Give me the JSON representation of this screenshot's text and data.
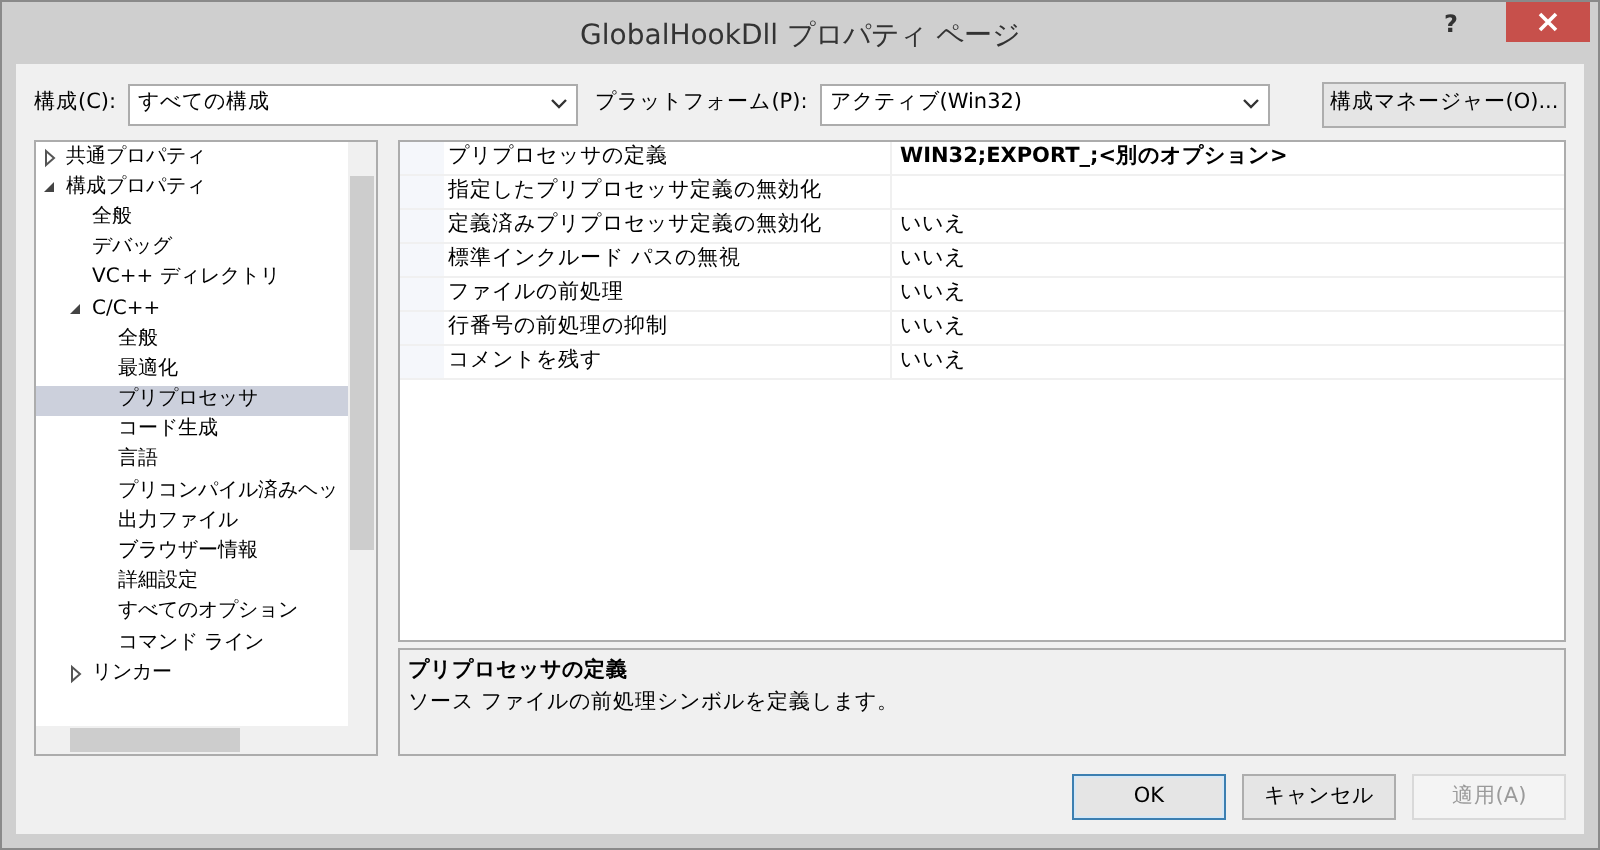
{
  "window": {
    "title": "GlobalHookDll プロパティ ページ",
    "help": "?"
  },
  "toolbar": {
    "config_label": "構成(C):",
    "config_value": "すべての構成",
    "platform_label": "プラットフォーム(P):",
    "platform_value": "アクティブ(Win32)",
    "manager_button": "構成マネージャー(O)..."
  },
  "tree": [
    {
      "label": "共通プロパティ",
      "expanded": false,
      "selected": false
    },
    {
      "label": "構成プロパティ",
      "expanded": true,
      "selected": false,
      "children": [
        {
          "label": "全般",
          "selected": false
        },
        {
          "label": "デバッグ",
          "selected": false
        },
        {
          "label": "VC++ ディレクトリ",
          "selected": false
        },
        {
          "label": "C/C++",
          "expanded": true,
          "selected": false,
          "children": [
            {
              "label": "全般",
              "selected": false
            },
            {
              "label": "最適化",
              "selected": false
            },
            {
              "label": "プリプロセッサ",
              "selected": true
            },
            {
              "label": "コード生成",
              "selected": false
            },
            {
              "label": "言語",
              "selected": false
            },
            {
              "label": "プリコンパイル済みヘッ",
              "selected": false
            },
            {
              "label": "出力ファイル",
              "selected": false
            },
            {
              "label": "ブラウザー情報",
              "selected": false
            },
            {
              "label": "詳細設定",
              "selected": false
            },
            {
              "label": "すべてのオプション",
              "selected": false
            },
            {
              "label": "コマンド ライン",
              "selected": false
            }
          ]
        },
        {
          "label": "リンカー",
          "expanded": false,
          "selected": false
        }
      ]
    }
  ],
  "properties": [
    {
      "name": "プリプロセッサの定義",
      "value": "WIN32;EXPORT_;<別のオプション>",
      "modified": true
    },
    {
      "name": "指定したプリプロセッサ定義の無効化"
    },
    {
      "name": "定義済みプリプロセッサ定義の無効化",
      "value": "いいえ",
      "modified": false
    },
    {
      "name": "標準インクルード パスの無視",
      "value": "いいえ",
      "modified": false
    },
    {
      "name": "ファイルの前処理",
      "value": "いいえ",
      "modified": false
    },
    {
      "name": "行番号の前処理の抑制",
      "value": "いいえ",
      "modified": false
    },
    {
      "name": "コメントを残す",
      "value": "いいえ",
      "modified": false
    }
  ],
  "description": {
    "title": "プリプロセッサの定義",
    "text": "ソース ファイルの前処理シンボルを定義します。"
  },
  "buttons": [
    {
      "label": "OK",
      "default": true,
      "disabled": false
    },
    {
      "label": "キャンセル",
      "default": false,
      "disabled": false
    },
    {
      "label": "適用(A)",
      "default": false,
      "disabled": true
    }
  ]
}
